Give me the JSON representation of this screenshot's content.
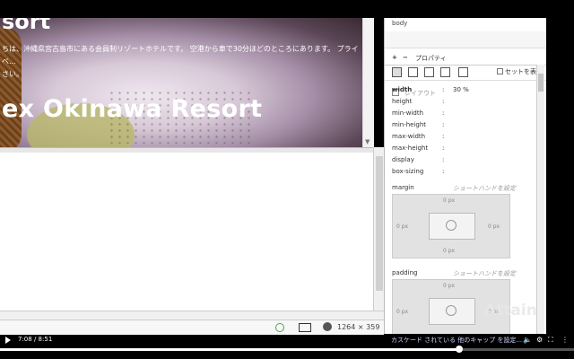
{
  "page": {
    "heading_fragment": "sort",
    "description": "ちは、沖縄県宮古島市にある会員制リゾートホテルです。 空港から車で30分ほどのところにあります。 プライベ...\nさい。",
    "hero_title": "ex Okinawa Resort"
  },
  "status_bar": {
    "viewport_size": "1264 × 359"
  },
  "panel": {
    "breadcrumb": "body",
    "tools_plus": "+",
    "tools_minus": "−",
    "tools_label": "プロパティ",
    "set_display_label": "セットを表示",
    "section_title": "レイアウト",
    "properties": [
      {
        "name": "width",
        "value": "30 %"
      },
      {
        "name": "height",
        "value": ""
      },
      {
        "name": "min-width",
        "value": ""
      },
      {
        "name": "min-height",
        "value": ""
      },
      {
        "name": "max-width",
        "value": ""
      },
      {
        "name": "max-height",
        "value": ""
      },
      {
        "name": "display",
        "value": ""
      },
      {
        "name": "box-sizing",
        "value": ""
      }
    ],
    "margin": {
      "label": "margin",
      "shorthand": "ショートハンドを設定",
      "top": "0 px",
      "left": "0 px",
      "right": "0 px",
      "bottom": "0 px"
    },
    "padding": {
      "label": "padding",
      "shorthand": "ショートハンドを設定",
      "top": "0 px",
      "left": "0 px",
      "right": "0 px"
    }
  },
  "watermark": "Attain",
  "caption": "カスケード されている 他のキャップ を設定...",
  "video": {
    "current_time": "7:08",
    "duration": "8:51",
    "progress_pct": 80
  }
}
